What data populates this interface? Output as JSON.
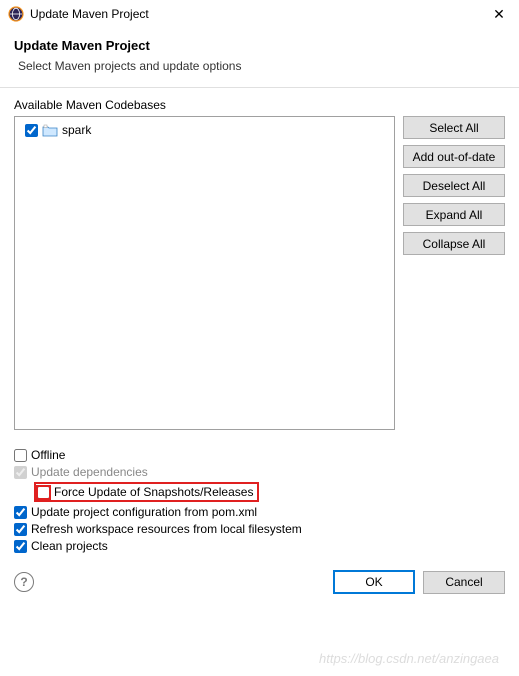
{
  "titlebar": {
    "title": "Update Maven Project"
  },
  "header": {
    "title": "Update Maven Project",
    "subtitle": "Select Maven projects and update options"
  },
  "codebase": {
    "label": "Available Maven Codebases",
    "items": [
      {
        "name": "spark",
        "checked": true
      }
    ]
  },
  "buttons": {
    "selectAll": "Select All",
    "addOutOfDate": "Add out-of-date",
    "deselectAll": "Deselect All",
    "expandAll": "Expand All",
    "collapseAll": "Collapse All"
  },
  "options": {
    "offline": "Offline",
    "updateDeps": "Update dependencies",
    "forceUpdate": "Force Update of Snapshots/Releases",
    "updateConfig": "Update project configuration from pom.xml",
    "refreshWorkspace": "Refresh workspace resources from local filesystem",
    "cleanProjects": "Clean projects"
  },
  "footer": {
    "ok": "OK",
    "cancel": "Cancel"
  },
  "watermark": "https://blog.csdn.net/anzingaea"
}
